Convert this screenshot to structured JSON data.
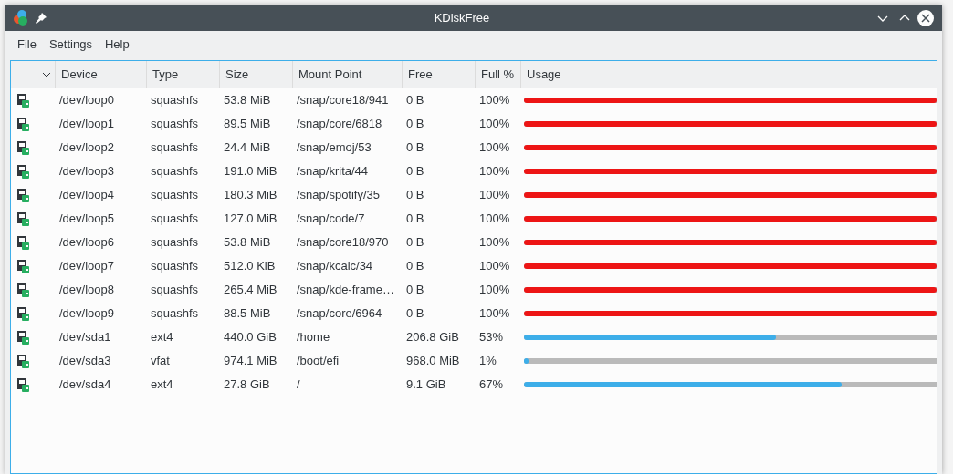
{
  "window": {
    "title": "KDiskFree"
  },
  "menu": [
    "File",
    "Settings",
    "Help"
  ],
  "table": {
    "columns": [
      "Device",
      "Type",
      "Size",
      "Mount Point",
      "Free",
      "Full %",
      "Usage"
    ],
    "rows": [
      {
        "device": "/dev/loop0",
        "type": "squashfs",
        "size": "53.8 MiB",
        "mount": "/snap/core18/941",
        "free": "0 B",
        "full": "100%",
        "level": 1,
        "critical": true
      },
      {
        "device": "/dev/loop1",
        "type": "squashfs",
        "size": "89.5 MiB",
        "mount": "/snap/core/6818",
        "free": "0 B",
        "full": "100%",
        "level": 1,
        "critical": true
      },
      {
        "device": "/dev/loop2",
        "type": "squashfs",
        "size": "24.4 MiB",
        "mount": "/snap/emoj/53",
        "free": "0 B",
        "full": "100%",
        "level": 1,
        "critical": true
      },
      {
        "device": "/dev/loop3",
        "type": "squashfs",
        "size": "191.0 MiB",
        "mount": "/snap/krita/44",
        "free": "0 B",
        "full": "100%",
        "level": 1,
        "critical": true
      },
      {
        "device": "/dev/loop4",
        "type": "squashfs",
        "size": "180.3 MiB",
        "mount": "/snap/spotify/35",
        "free": "0 B",
        "full": "100%",
        "level": 1,
        "critical": true
      },
      {
        "device": "/dev/loop5",
        "type": "squashfs",
        "size": "127.0 MiB",
        "mount": "/snap/code/7",
        "free": "0 B",
        "full": "100%",
        "level": 1,
        "critical": true
      },
      {
        "device": "/dev/loop6",
        "type": "squashfs",
        "size": "53.8 MiB",
        "mount": "/snap/core18/970",
        "free": "0 B",
        "full": "100%",
        "level": 1,
        "critical": true
      },
      {
        "device": "/dev/loop7",
        "type": "squashfs",
        "size": "512.0 KiB",
        "mount": "/snap/kcalc/34",
        "free": "0 B",
        "full": "100%",
        "level": 1,
        "critical": true
      },
      {
        "device": "/dev/loop8",
        "type": "squashfs",
        "size": "265.4 MiB",
        "mount": "/snap/kde-frame…",
        "free": "0 B",
        "full": "100%",
        "level": 1,
        "critical": true
      },
      {
        "device": "/dev/loop9",
        "type": "squashfs",
        "size": "88.5 MiB",
        "mount": "/snap/core/6964",
        "free": "0 B",
        "full": "100%",
        "level": 1,
        "critical": true
      },
      {
        "device": "/dev/sda1",
        "type": "ext4",
        "size": "440.0 GiB",
        "mount": "/home",
        "free": "206.8 GiB",
        "full": "53%",
        "level": 0.61,
        "critical": false
      },
      {
        "device": "/dev/sda3",
        "type": "vfat",
        "size": "974.1 MiB",
        "mount": "/boot/efi",
        "free": "968.0 MiB",
        "full": "1%",
        "level": 0.01,
        "critical": false
      },
      {
        "device": "/dev/sda4",
        "type": "ext4",
        "size": "27.8 GiB",
        "mount": "/",
        "free": "9.1 GiB",
        "full": "67%",
        "level": 0.77,
        "critical": false
      }
    ]
  }
}
